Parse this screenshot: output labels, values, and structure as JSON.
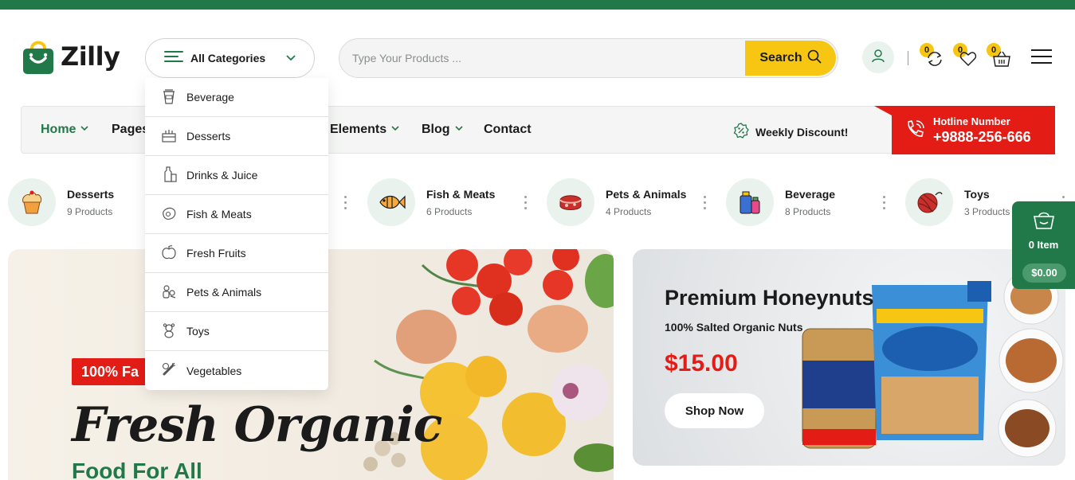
{
  "brand": {
    "name": "Zilly"
  },
  "header": {
    "categories_label": "All Categories",
    "search_placeholder": "Type Your Products ...",
    "search_button": "Search",
    "compare_count": "0",
    "wishlist_count": "0",
    "cart_count": "0"
  },
  "nav": {
    "items": [
      {
        "label": "Home",
        "active": true,
        "has_dropdown": true
      },
      {
        "label": "Pages",
        "has_dropdown": true
      },
      {
        "label": "Elements",
        "has_dropdown": true
      },
      {
        "label": "Blog",
        "has_dropdown": true
      },
      {
        "label": "Contact",
        "has_dropdown": false
      }
    ],
    "weekly_discount": "Weekly Discount!",
    "hotline_label": "Hotline Number",
    "hotline_number": "+9888-256-666"
  },
  "dropdown": {
    "items": [
      "Beverage",
      "Desserts",
      "Drinks & Juice",
      "Fish & Meats",
      "Fresh Fruits",
      "Pets & Animals",
      "Toys",
      "Vegetables"
    ]
  },
  "category_strip": [
    {
      "name": "Desserts",
      "count": "9 Products",
      "icon": "cupcake-icon"
    },
    {
      "name": "Fish & Meats",
      "count": "6 Products",
      "icon": "fish-icon"
    },
    {
      "name": "Pets & Animals",
      "count": "4 Products",
      "icon": "meat-icon"
    },
    {
      "name": "Beverage",
      "count": "8 Products",
      "icon": "beverage-icon"
    },
    {
      "name": "Toys",
      "count": "3 Products",
      "icon": "yarn-ball-icon"
    }
  ],
  "hero": {
    "badge": "100% Fa",
    "headline": "Fresh Organic",
    "subheadline": "Food For All"
  },
  "promo": {
    "title": "Premium Honeynuts",
    "subtitle": "100% Salted Organic Nuts",
    "price": "$15.00",
    "button": "Shop Now"
  },
  "floating_cart": {
    "items": "0 Item",
    "total": "$0.00"
  },
  "colors": {
    "brand_green": "#21794a",
    "accent_yellow": "#f7c613",
    "hotline_red": "#e41c16"
  }
}
